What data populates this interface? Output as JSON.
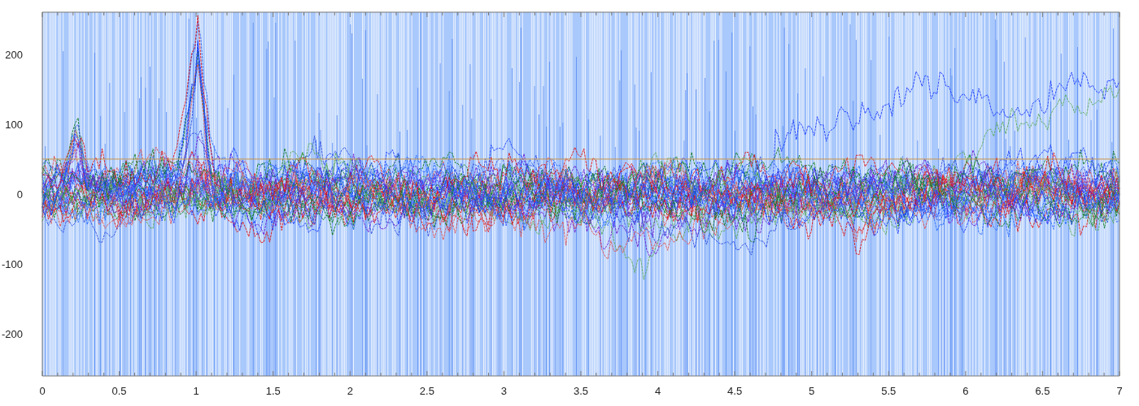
{
  "chart": {
    "xticks": [
      "0",
      "0.5",
      "1",
      "1.5",
      "2",
      "2.5",
      "3",
      "3.5",
      "4",
      "4.5",
      "5",
      "5.5",
      "6",
      "6.5",
      "7"
    ],
    "yticks": [
      "200",
      "100",
      "0",
      "-100",
      "-200"
    ]
  }
}
